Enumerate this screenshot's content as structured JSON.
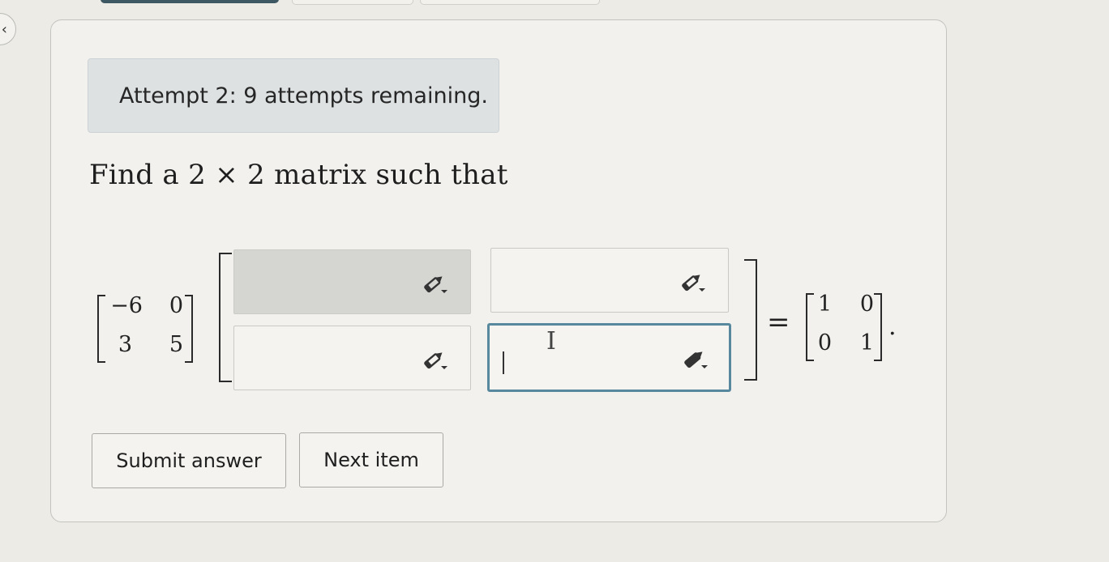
{
  "attempt_banner": {
    "text": "Attempt 2: 9 attempts remaining."
  },
  "prompt": {
    "text": "Find a 2 × 2 matrix such that"
  },
  "left_matrix": {
    "r1c1": "−6",
    "r1c2": "0",
    "r2c1": "3",
    "r2c2": "5"
  },
  "answer_matrix": {
    "cells": [
      {
        "value": "",
        "state": "filled"
      },
      {
        "value": "",
        "state": "empty"
      },
      {
        "value": "",
        "state": "empty"
      },
      {
        "value": "",
        "state": "focused"
      }
    ],
    "editor_icon": "pencil-dropdown-icon"
  },
  "equals": "=",
  "identity_matrix": {
    "r1c1": "1",
    "r1c2": "0",
    "r2c1": "0",
    "r2c2": "1"
  },
  "period": ".",
  "buttons": {
    "submit_label": "Submit answer",
    "next_label": "Next item"
  },
  "back_button": {
    "icon": "chevron-left-icon",
    "glyph": "‹"
  },
  "colors": {
    "focus_border": "#58889e",
    "banner_bg": "#dde1e2",
    "active_tab": "#3e5863"
  }
}
